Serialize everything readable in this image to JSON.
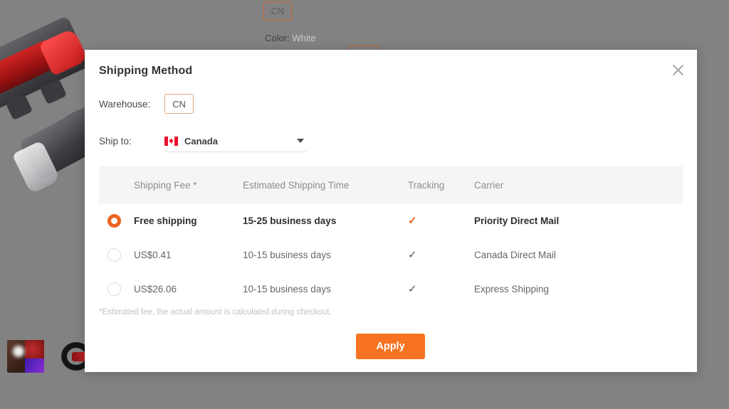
{
  "background": {
    "warehouse_chip": "CN",
    "color_label": "Color:",
    "color_value": "White"
  },
  "modal": {
    "title": "Shipping Method",
    "close_icon": "close-icon",
    "warehouse": {
      "label": "Warehouse:",
      "selected": "CN"
    },
    "ship_to": {
      "label": "Ship to:",
      "country": "Canada",
      "flag_icon": "canada-flag-icon",
      "caret_icon": "chevron-down-icon"
    },
    "table": {
      "headers": [
        "Shipping Fee *",
        "Estimated Shipping Time",
        "Tracking",
        "Carrier"
      ],
      "rows": [
        {
          "selected": true,
          "fee": "Free shipping",
          "time": "15-25 business days",
          "tracking": "✓",
          "carrier": "Priority Direct Mail"
        },
        {
          "selected": false,
          "fee": "US$0.41",
          "time": "10-15 business days",
          "tracking": "✓",
          "carrier": "Canada Direct Mail"
        },
        {
          "selected": false,
          "fee": "US$26.06",
          "time": "10-15 business days",
          "tracking": "✓",
          "carrier": "Express Shipping"
        }
      ]
    },
    "footnote": "*Estimated fee, the actual amount is calculated during checkout.",
    "apply_label": "Apply"
  },
  "colors": {
    "accent": "#f77321",
    "radio_selected": "#ee6322",
    "chip_border": "#e4a87e",
    "page_backdrop": "#828282",
    "table_header_bg": "#f5f5f5"
  }
}
